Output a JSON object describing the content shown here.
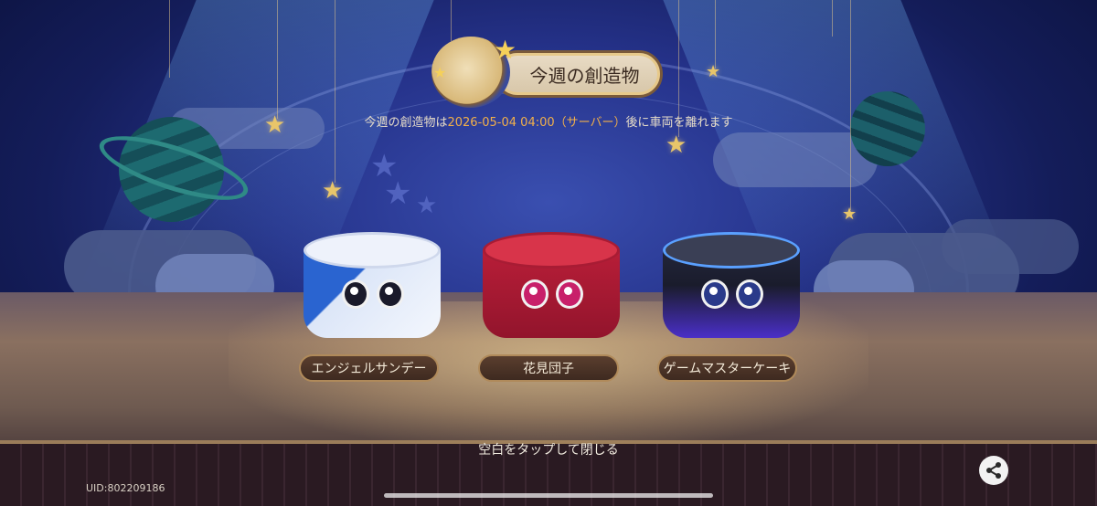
{
  "header": {
    "title": "今週の創造物",
    "subtitle_prefix": "今週の創造物は",
    "subtitle_datetime": "2026-05-04 04:00（サーバー）",
    "subtitle_suffix": "後に車両を離れます"
  },
  "creations": [
    {
      "name": "エンジェルサンデー",
      "top_color": "#eef2fb",
      "body_color": "#2f6fd8",
      "accent": "#ffffff"
    },
    {
      "name": "花見団子",
      "top_color": "#d8344a",
      "body_color": "#b8203a",
      "accent": "#f6c1cf"
    },
    {
      "name": "ゲームマスターケーキ",
      "top_color": "#3a3f55",
      "body_color": "#1c1f2e",
      "accent": "#6a4cff"
    }
  ],
  "footer": {
    "close_hint": "空白をタップして閉じる",
    "uid": "UID:802209186"
  },
  "icons": {
    "share": "share-icon",
    "title_emblem": "cake-creature-emblem",
    "stars": "star-icon"
  },
  "colors": {
    "highlight_text": "#f2b04a",
    "pill_bg": "#4a3226",
    "pill_border": "#b08a5a"
  }
}
